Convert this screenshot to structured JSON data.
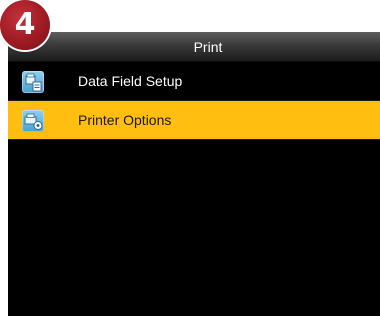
{
  "step_badge": "4",
  "header": {
    "title": "Print"
  },
  "menu": {
    "items": [
      {
        "label": "Data Field Setup",
        "icon": "data-field-icon",
        "selected": false
      },
      {
        "label": "Printer Options",
        "icon": "printer-options-icon",
        "selected": true
      }
    ]
  },
  "colors": {
    "selection": "#ffbe10",
    "background": "#000000",
    "badge": "#9e1b24"
  }
}
